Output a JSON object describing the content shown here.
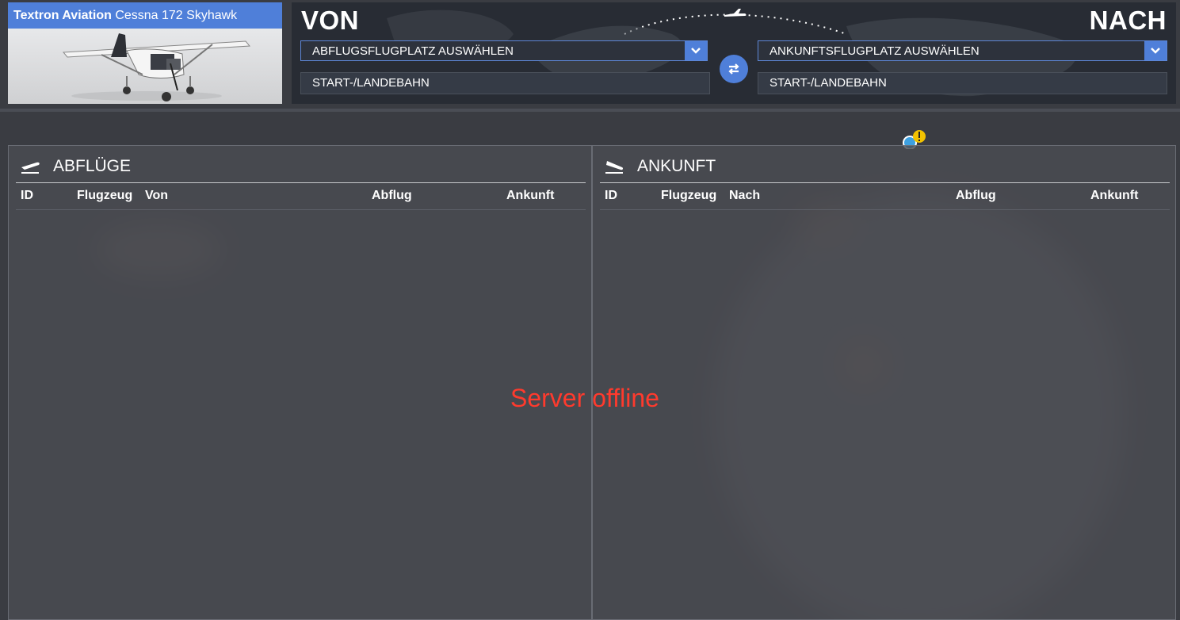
{
  "aircraft": {
    "maker": "Textron Aviation",
    "model": "Cessna 172 Skyhawk"
  },
  "route": {
    "from_label": "VON",
    "to_label": "NACH",
    "departure_select": "ABFLUGSFLUGPLATZ AUSWÄHLEN",
    "arrival_select": "ANKUNFTSFLUGPLATZ AUSWÄHLEN",
    "departure_runway": "START-/LANDEBAHN",
    "arrival_runway": "START-/LANDEBAHN"
  },
  "departures": {
    "title": "ABFLÜGE",
    "columns": [
      "ID",
      "Flugzeug",
      "Von",
      "Abflug",
      "Ankunft"
    ]
  },
  "arrivals": {
    "title": "ANKUNFT",
    "columns": [
      "ID",
      "Flugzeug",
      "Nach",
      "Abflug",
      "Ankunft"
    ]
  },
  "status": "Server offline",
  "colors": {
    "accent": "#4f7fd9",
    "error": "#ff3a2d"
  }
}
